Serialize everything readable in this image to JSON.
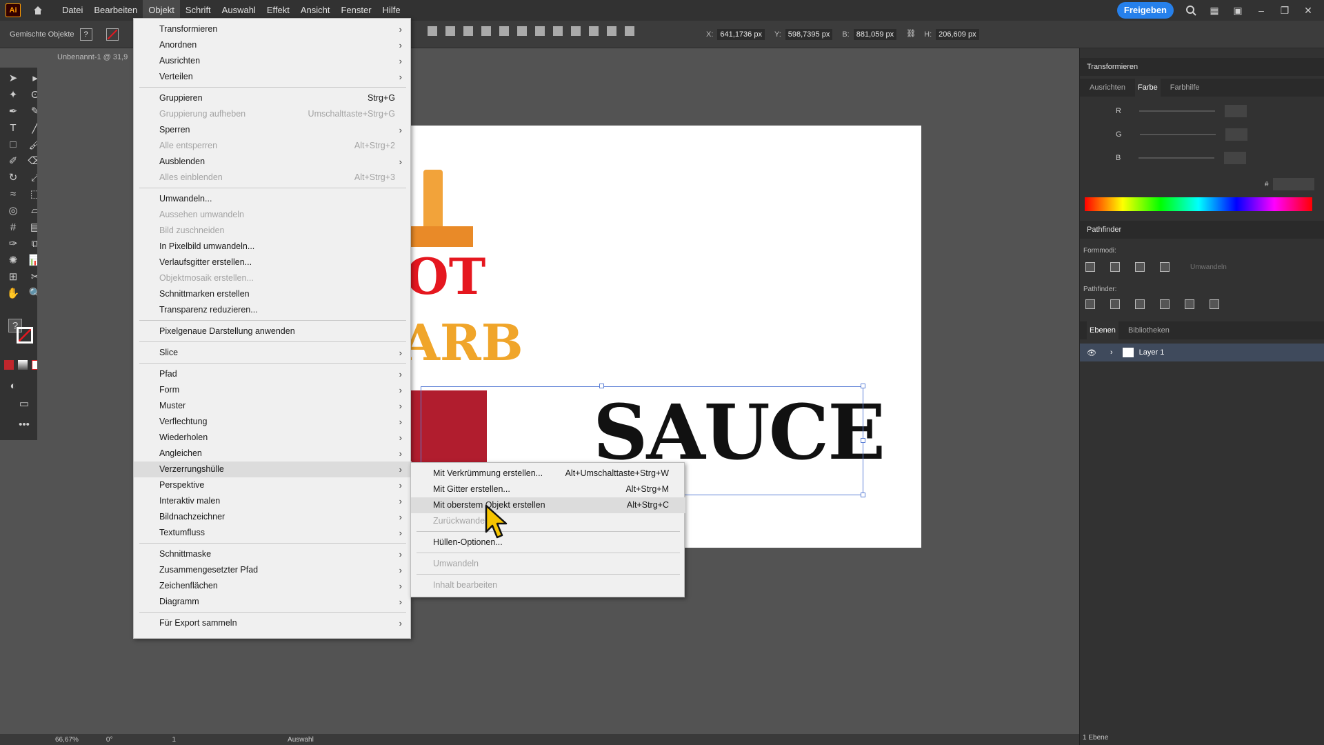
{
  "app": {
    "logo": "Ai",
    "document_tab": "Unbenannt-1 @ 31,9",
    "share_button": "Freigeben"
  },
  "menubar": {
    "items": [
      "Datei",
      "Bearbeiten",
      "Objekt",
      "Schrift",
      "Auswahl",
      "Effekt",
      "Ansicht",
      "Fenster",
      "Hilfe"
    ],
    "active": "Objekt"
  },
  "controlbar": {
    "selection_label": "Gemischte Objekte",
    "x_label": "X:",
    "x_value": "641,1736 px",
    "y_label": "Y:",
    "y_value": "598,7395 px",
    "w_label": "B:",
    "w_value": "881,059 px",
    "h_label": "H:",
    "h_value": "206,609 px"
  },
  "objekt_menu": [
    {
      "label": "Transformieren",
      "submenu": true
    },
    {
      "label": "Anordnen",
      "submenu": true
    },
    {
      "label": "Ausrichten",
      "submenu": true
    },
    {
      "label": "Verteilen",
      "submenu": true
    },
    {
      "sep": true
    },
    {
      "label": "Gruppieren",
      "shortcut": "Strg+G"
    },
    {
      "label": "Gruppierung aufheben",
      "shortcut": "Umschalttaste+Strg+G",
      "disabled": true
    },
    {
      "label": "Sperren",
      "submenu": true
    },
    {
      "label": "Alle entsperren",
      "shortcut": "Alt+Strg+2",
      "disabled": true
    },
    {
      "label": "Ausblenden",
      "submenu": true
    },
    {
      "label": "Alles einblenden",
      "shortcut": "Alt+Strg+3",
      "disabled": true
    },
    {
      "sep": true
    },
    {
      "label": "Umwandeln..."
    },
    {
      "label": "Aussehen umwandeln",
      "disabled": true
    },
    {
      "label": "Bild zuschneiden",
      "disabled": true
    },
    {
      "label": "In Pixelbild umwandeln..."
    },
    {
      "label": "Verlaufsgitter erstellen..."
    },
    {
      "label": "Objektmosaik erstellen...",
      "disabled": true
    },
    {
      "label": "Schnittmarken erstellen"
    },
    {
      "label": "Transparenz reduzieren..."
    },
    {
      "sep": true
    },
    {
      "label": "Pixelgenaue Darstellung anwenden"
    },
    {
      "sep": true
    },
    {
      "label": "Slice",
      "submenu": true
    },
    {
      "sep": true
    },
    {
      "label": "Pfad",
      "submenu": true
    },
    {
      "label": "Form",
      "submenu": true
    },
    {
      "label": "Muster",
      "submenu": true
    },
    {
      "label": "Verflechtung",
      "submenu": true
    },
    {
      "label": "Wiederholen",
      "submenu": true
    },
    {
      "label": "Angleichen",
      "submenu": true
    },
    {
      "label": "Verzerrungshülle",
      "submenu": true,
      "hover": true
    },
    {
      "label": "Perspektive",
      "submenu": true
    },
    {
      "label": "Interaktiv malen",
      "submenu": true
    },
    {
      "label": "Bildnachzeichner",
      "submenu": true
    },
    {
      "label": "Textumfluss",
      "submenu": true
    },
    {
      "sep": true
    },
    {
      "label": "Schnittmaske",
      "submenu": true
    },
    {
      "label": "Zusammengesetzter Pfad",
      "submenu": true
    },
    {
      "label": "Zeichenflächen",
      "submenu": true
    },
    {
      "label": "Diagramm",
      "submenu": true
    },
    {
      "sep": true
    },
    {
      "label": "Für Export sammeln",
      "submenu": true
    }
  ],
  "envelope_submenu": [
    {
      "label": "Mit Verkrümmung erstellen...",
      "shortcut": "Alt+Umschalttaste+Strg+W"
    },
    {
      "label": "Mit Gitter erstellen...",
      "shortcut": "Alt+Strg+M"
    },
    {
      "label": "Mit oberstem Objekt erstellen",
      "shortcut": "Alt+Strg+C",
      "hover": true
    },
    {
      "label": "Zurückwandeln",
      "disabled": true
    },
    {
      "sep": true
    },
    {
      "label": "Hüllen-Optionen..."
    },
    {
      "sep": true
    },
    {
      "label": "Umwandeln",
      "disabled": true
    },
    {
      "sep": true
    },
    {
      "label": "Inhalt bearbeiten",
      "disabled": true
    }
  ],
  "artwork": {
    "hot": "OT",
    "barb": "ARB",
    "sauce": "SAUCE"
  },
  "right_panel": {
    "transform_title": "Transformieren",
    "tabs": [
      "Ausrichten",
      "Farbe",
      "Farbhilfe"
    ],
    "selected_tab": "Farbe",
    "rgb": [
      "R",
      "G",
      "B"
    ],
    "hex_label": "#",
    "pathfinder_title": "Pathfinder",
    "formmodi_label": "Formmodi:",
    "umwandeln_label": "Umwandeln",
    "pathfinder_label": "Pathfinder:",
    "layer_tabs": [
      "Ebenen",
      "Bibliotheken"
    ],
    "layer_name": "Layer 1",
    "layer_count": "1 Ebene"
  },
  "statusbar": {
    "zoom": "66,67%",
    "rotation": "0°",
    "artboard": "1",
    "mode": "Auswahl"
  },
  "colors": {
    "menu_bg": "#f0f0f0",
    "accent": "#2680eb",
    "hot_red": "#e5171f",
    "barb_orange": "#f0a52a",
    "bottle_red": "#b11d2e"
  }
}
